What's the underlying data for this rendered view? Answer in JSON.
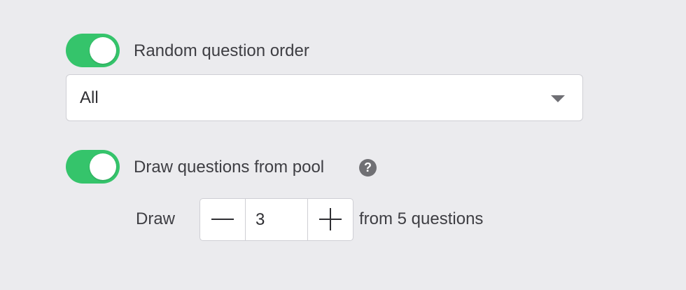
{
  "random_order": {
    "label": "Random question order",
    "enabled": true,
    "select": {
      "value": "All"
    }
  },
  "draw_pool": {
    "label": "Draw questions from pool",
    "enabled": true,
    "help_icon": "question-circle-icon",
    "help_glyph": "?",
    "draw_label": "Draw",
    "count": "3",
    "from_text": "from 5 questions"
  },
  "colors": {
    "toggle_on": "#35c46b",
    "background": "#ebebee"
  }
}
